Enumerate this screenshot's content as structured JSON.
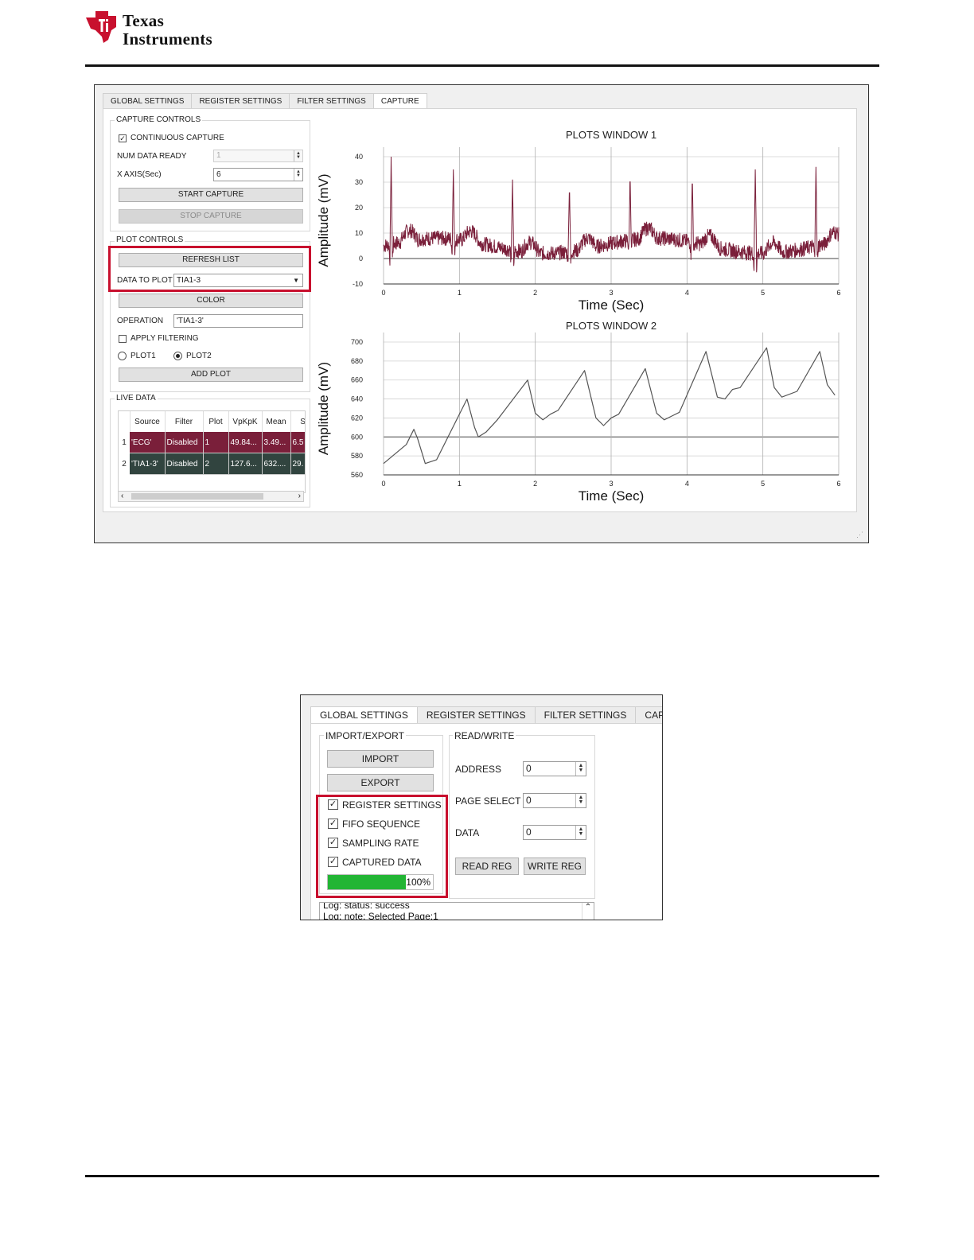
{
  "header": {
    "brand_line1": "Texas",
    "brand_line2": "Instruments"
  },
  "capture_gui": {
    "tabs": [
      "GLOBAL SETTINGS",
      "REGISTER SETTINGS",
      "FILTER SETTINGS",
      "CAPTURE"
    ],
    "capture_controls": {
      "title": "CAPTURE CONTROLS",
      "continuous_capture": "CONTINUOUS CAPTURE",
      "num_data_ready_label": "NUM DATA READY",
      "num_data_ready_value": "1",
      "x_axis_label": "X AXIS(Sec)",
      "x_axis_value": "6",
      "start_capture": "START CAPTURE",
      "stop_capture": "STOP CAPTURE"
    },
    "plot_controls": {
      "title": "PLOT CONTROLS",
      "refresh_list": "REFRESH LIST",
      "data_to_plot_label": "DATA TO PLOT",
      "data_to_plot_value": "TIA1-3",
      "color": "COLOR",
      "operation_label": "OPERATION",
      "operation_value": "'TIA1-3'",
      "apply_filtering": "APPLY FILTERING",
      "plot1": "PLOT1",
      "plot2": "PLOT2",
      "add_plot": "ADD PLOT"
    },
    "live_data": {
      "title": "LIVE DATA",
      "columns": [
        "Source",
        "Filter",
        "Plot",
        "VpKpK",
        "Mean",
        "St"
      ],
      "rows": [
        {
          "num": "1",
          "cells": [
            "'ECG'",
            "Disabled",
            "1",
            "49.84...",
            "3.49...",
            "6.5"
          ]
        },
        {
          "num": "2",
          "cells": [
            "'TIA1-3'",
            "Disabled",
            "2",
            "127.6...",
            "632....",
            "29."
          ]
        }
      ]
    },
    "colors": {
      "ecg_trace": "#7a1f3a",
      "tia_trace": "#555555",
      "highlight": "#c8102e",
      "row1": "#7a1f3a",
      "row2": "#31443f"
    }
  },
  "chart_data": [
    {
      "type": "line",
      "title": "PLOTS WINDOW 1",
      "xlabel": "Time (Sec)",
      "ylabel": "Amplitude (mV)",
      "xlim": [
        0,
        6
      ],
      "ylim": [
        -10,
        40
      ],
      "x_ticks": [
        "0",
        "1",
        "2",
        "3",
        "4",
        "5",
        "6"
      ],
      "y_ticks": [
        "-10",
        "0",
        "10",
        "20",
        "30",
        "40"
      ],
      "grid": true,
      "series": [
        {
          "peaks_x": [
            0.1,
            0.92,
            1.7,
            2.45,
            3.25,
            4.07,
            4.9,
            5.7
          ],
          "peaks_y": [
            40,
            35,
            31,
            29,
            34,
            33,
            35,
            36
          ],
          "baseline": 5
        }
      ]
    },
    {
      "type": "line",
      "title": "PLOTS WINDOW 2",
      "xlabel": "Time (Sec)",
      "ylabel": "Amplitude (mV)",
      "xlim": [
        0,
        6
      ],
      "ylim": [
        560,
        700
      ],
      "x_ticks": [
        "0",
        "1",
        "2",
        "3",
        "4",
        "5",
        "6"
      ],
      "y_ticks": [
        "560",
        "580",
        "600",
        "620",
        "640",
        "660",
        "680",
        "700"
      ],
      "grid": true,
      "series": [
        {
          "x": [
            0,
            0.3,
            0.4,
            0.45,
            0.55,
            0.7,
            1.1,
            1.2,
            1.25,
            1.35,
            1.5,
            1.9,
            2.0,
            2.1,
            2.2,
            2.3,
            2.65,
            2.8,
            2.9,
            3.0,
            3.1,
            3.45,
            3.6,
            3.7,
            3.8,
            3.9,
            4.25,
            4.4,
            4.5,
            4.6,
            4.7,
            5.0,
            5.05,
            5.15,
            5.25,
            5.45,
            5.75,
            5.85,
            5.95
          ],
          "y": [
            572,
            592,
            608,
            598,
            572,
            576,
            640,
            610,
            600,
            605,
            618,
            660,
            625,
            618,
            624,
            628,
            670,
            620,
            612,
            620,
            624,
            672,
            625,
            618,
            622,
            626,
            690,
            642,
            640,
            650,
            652,
            688,
            694,
            652,
            642,
            648,
            690,
            655,
            644
          ]
        }
      ]
    }
  ],
  "settings_gui": {
    "tabs": [
      "GLOBAL SETTINGS",
      "REGISTER SETTINGS",
      "FILTER SETTINGS",
      "CAPTURE"
    ],
    "import_export": {
      "title": "IMPORT/EXPORT",
      "import": "IMPORT",
      "export": "EXPORT",
      "checks": [
        "REGISTER SETTINGS",
        "FIFO SEQUENCE",
        "SAMPLING RATE",
        "CAPTURED DATA"
      ],
      "progress": 100,
      "progress_label": "100%"
    },
    "read_write": {
      "title": "READ/WRITE",
      "address_label": "ADDRESS",
      "address_value": "0",
      "page_select_label": "PAGE SELECT",
      "page_select_value": "0",
      "data_label": "DATA",
      "data_value": "0",
      "read_reg": "READ REG",
      "write_reg": "WRITE REG"
    },
    "log": [
      "Log: status: success",
      "Log: note: Selected Page:1"
    ],
    "progress_color": "#22b534"
  }
}
